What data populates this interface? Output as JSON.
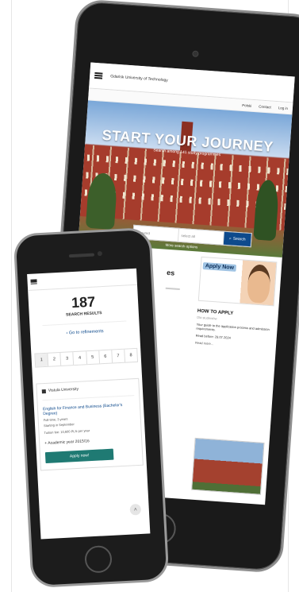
{
  "tablet": {
    "brand": "Gdańsk University of Technology",
    "lang": "Polski",
    "contact": "Contact",
    "login": "Log in",
    "hero_title": "START YOUR JOURNEY",
    "hero_subtitle": "Search among 141 study programmes",
    "search_field_placeholder": "Keyword",
    "search_select": "select all",
    "search_button": "Search",
    "hero_link": "More search options",
    "section_heading": "es",
    "ad_label": "Apply Now",
    "howto_title": "HOW TO APPLY",
    "howto_sub": "Dla studentów",
    "howto_text": "Your guide to the application process and admission requirements.",
    "howto_date": "Read before: 28.07.2024",
    "read_more": "Read more..."
  },
  "phone": {
    "results_count": "187",
    "results_label": "SEARCH RESULTS",
    "refine": "Go to refinements",
    "pages": [
      "1",
      "2",
      "3",
      "4",
      "5",
      "6",
      "7",
      "8"
    ],
    "card": {
      "university": "Vistula University",
      "programme": "English for Finance and Business (Bachelor's Degree)",
      "meta_1": "Full-time, 3 years",
      "meta_2": "Starting in September",
      "tuition": "Tuition fee: 10,600 PLN per year",
      "academic_year": "Academic year 2015/16",
      "apply_button": "Apply now!"
    }
  },
  "icons": {
    "menu": "hamburger-icon",
    "search": "search-icon",
    "back": "chevron-left-icon",
    "university": "building-icon",
    "expand": "plus-icon",
    "scroll_top": "chevron-up-icon"
  },
  "colors": {
    "primary": "#0e4a8c",
    "apply": "#1f7a73"
  }
}
